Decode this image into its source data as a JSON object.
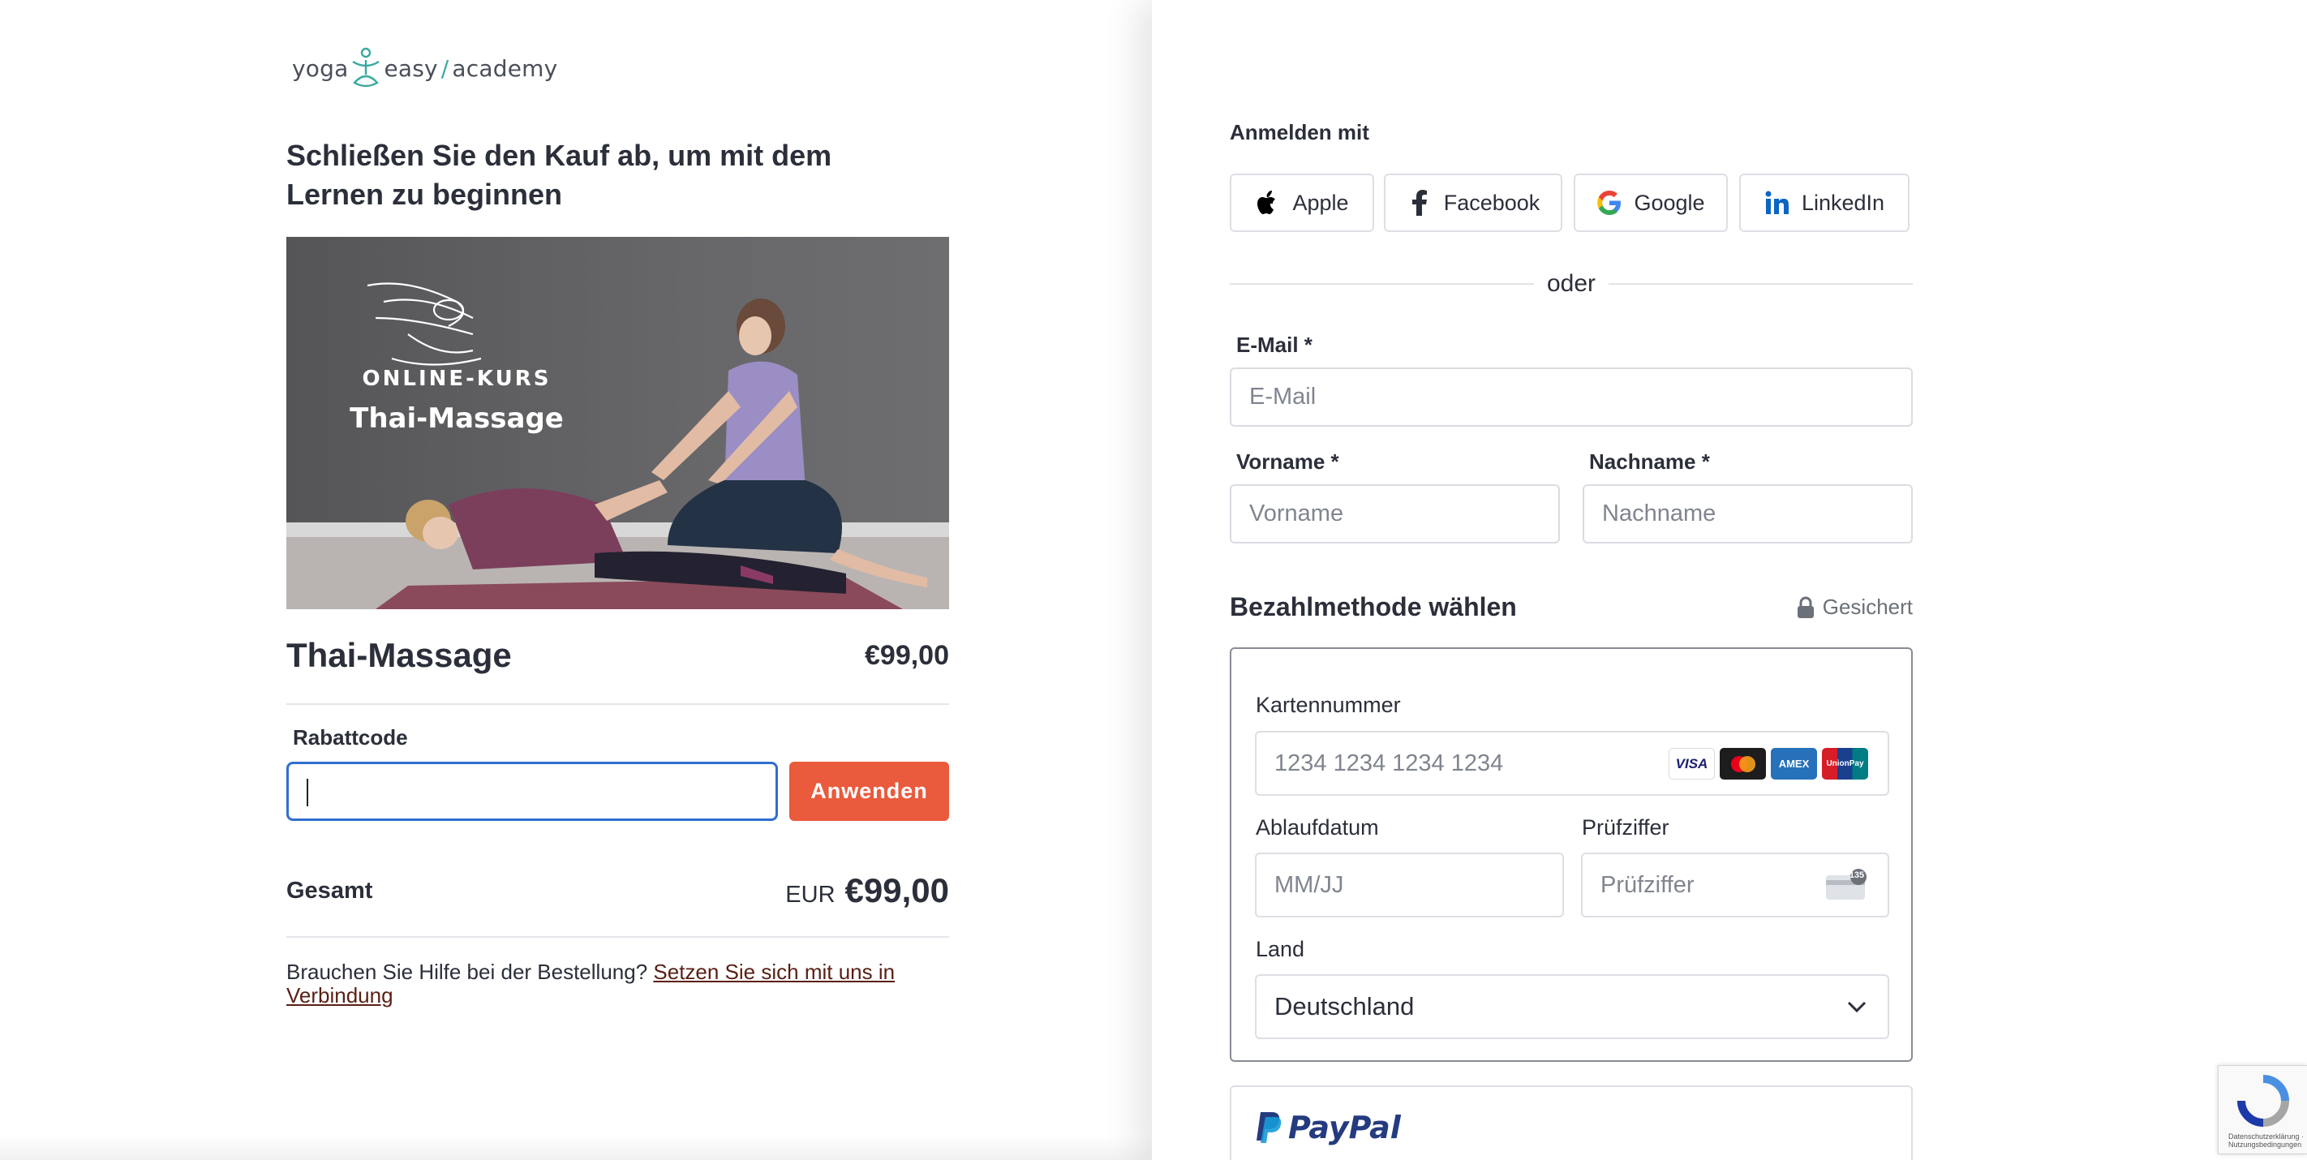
{
  "logo": {
    "part1": "yoga",
    "part2": "easy",
    "slash": "/",
    "part3": "academy"
  },
  "left": {
    "heading": "Schließen Sie den Kauf ab, um mit dem Lernen zu beginnen",
    "course_image": {
      "kicker": "ONLINE-KURS",
      "title": "Thai-Massage"
    },
    "product": {
      "name": "Thai-Massage",
      "price": "€99,00"
    },
    "discount": {
      "label": "Rabattcode",
      "value": "",
      "button": "Anwenden"
    },
    "total": {
      "label": "Gesamt",
      "currency": "EUR",
      "amount": "€99,00"
    },
    "help": {
      "text": "Brauchen Sie Hilfe bei der Bestellung? ",
      "link": "Setzen Sie sich mit uns in Verbindung"
    }
  },
  "right": {
    "login_with": "Anmelden mit",
    "social": [
      {
        "label": "Apple",
        "icon": "apple-icon"
      },
      {
        "label": "Facebook",
        "icon": "facebook-icon"
      },
      {
        "label": "Google",
        "icon": "google-icon"
      },
      {
        "label": "LinkedIn",
        "icon": "linkedin-icon"
      }
    ],
    "divider": "oder",
    "email": {
      "label": "E-Mail *",
      "placeholder": "E-Mail"
    },
    "firstname": {
      "label": "Vorname *",
      "placeholder": "Vorname"
    },
    "lastname": {
      "label": "Nachname *",
      "placeholder": "Nachname"
    },
    "payment": {
      "title": "Bezahlmethode wählen",
      "secure": "Gesichert",
      "card_number": {
        "label": "Kartennummer",
        "placeholder": "1234 1234 1234 1234"
      },
      "brands": [
        "VISA",
        "Mastercard",
        "AMEX",
        "UnionPay"
      ],
      "expiry": {
        "label": "Ablaufdatum",
        "placeholder": "MM/JJ"
      },
      "cvc": {
        "label": "Prüfziffer",
        "placeholder": "Prüfziffer",
        "badge": "135"
      },
      "country": {
        "label": "Land",
        "value": "Deutschland"
      },
      "paypal": "PayPal"
    },
    "recaptcha": "Datenschutzerklärung · Nutzungsbedingungen"
  },
  "colors": {
    "accent": "#ea5a3c",
    "focus": "#2f6fcf",
    "text": "#2b2f3a",
    "teal": "#3aa99f",
    "paypal_dark": "#253b80",
    "paypal_light": "#179bd7"
  }
}
